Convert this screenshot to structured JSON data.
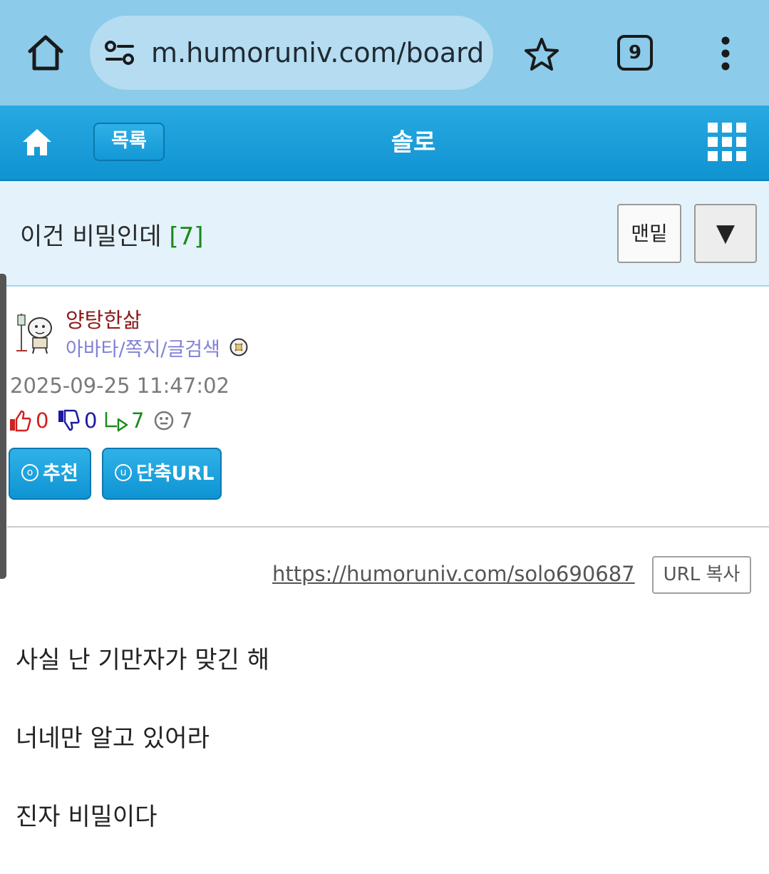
{
  "browser": {
    "url": "m.humoruniv.com/board",
    "tab_count": "9",
    "icons": [
      "home-icon",
      "site-settings-icon",
      "star-icon",
      "tabs-icon",
      "more-vert-icon"
    ]
  },
  "site_header": {
    "list_label": "목록",
    "board_title": "솔로",
    "icons": [
      "home-icon",
      "grid-menu-icon"
    ]
  },
  "post": {
    "title": "이건 비밀인데",
    "comment_count": "[7]",
    "bottom_label": "맨밑",
    "down_arrow": "▼",
    "author": "양탕한삶",
    "author_links": "아바타/쪽지/글검색",
    "date": "2025-09-25 11:47:02",
    "stats": {
      "likes": "0",
      "dislikes": "0",
      "replies": "7",
      "views": "7"
    },
    "recommend_label": "추천",
    "recommend_badge": "o",
    "short_url_label": "단축URL",
    "short_url_badge": "u",
    "short_url": "https://humoruniv.com/solo690687",
    "copy_label": "URL 복사",
    "body": [
      "사실 난 기만자가 맞긴 해",
      "너네만 알고 있어라",
      "진자 비밀이다"
    ]
  },
  "colors": {
    "chrome_bg": "#8ccbea",
    "header_blue": "#1a9dd9",
    "title_band": "#e4f3fb",
    "author_red": "#8b1a1a",
    "link_purple": "#8080d8",
    "like_red": "#d21f1f",
    "dislike_blue": "#1a1aa0",
    "reply_green": "#1a8a1a"
  }
}
